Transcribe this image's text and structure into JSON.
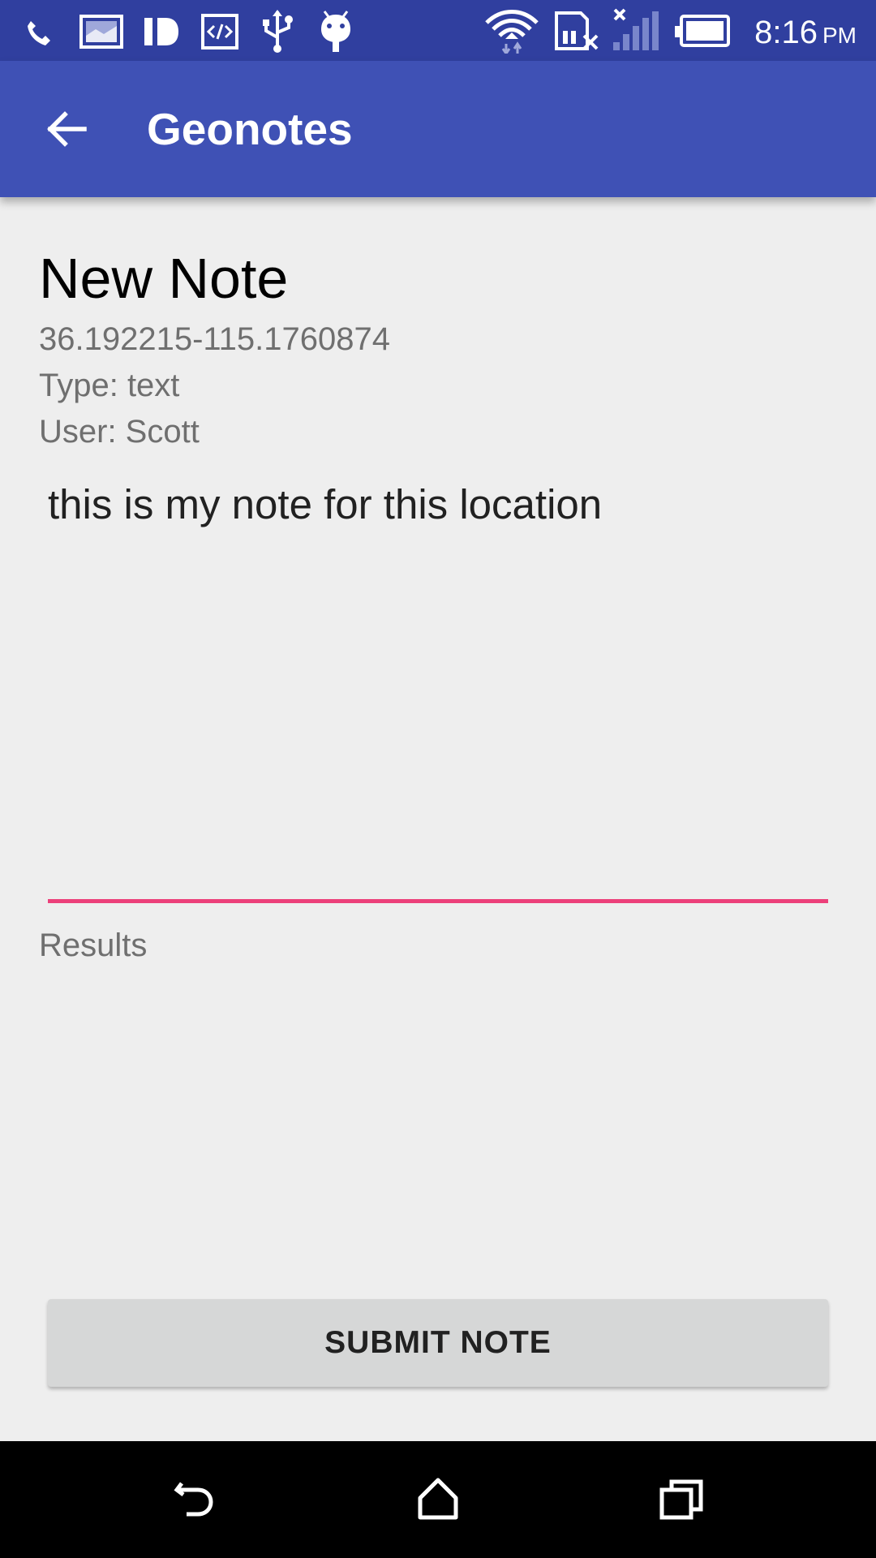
{
  "status_bar": {
    "time": "8:16",
    "ampm": "PM",
    "icons": [
      "missed-call-icon",
      "image-icon",
      "pandora-icon",
      "code-icon",
      "usb-icon",
      "android-debug-icon",
      "wifi-icon",
      "no-sim-icon",
      "signal-icon",
      "battery-icon"
    ]
  },
  "app_bar": {
    "title": "Geonotes",
    "back_icon": "arrow-back-icon"
  },
  "note": {
    "heading": "New Note",
    "coordinates": "36.192215-115.1760874",
    "type_line": "Type: text",
    "user_line": "User: Scott",
    "body": "this is my note for this location"
  },
  "results": {
    "label": "Results"
  },
  "submit": {
    "label": "SUBMIT NOTE"
  },
  "colors": {
    "status_bar": "#303f9f",
    "app_bar": "#3f51b5",
    "accent": "#ec407a",
    "background": "#eeeeee",
    "button": "#d6d7d7"
  },
  "nav_bar": {
    "icons": [
      "nav-back-icon",
      "nav-home-icon",
      "nav-recents-icon"
    ]
  }
}
